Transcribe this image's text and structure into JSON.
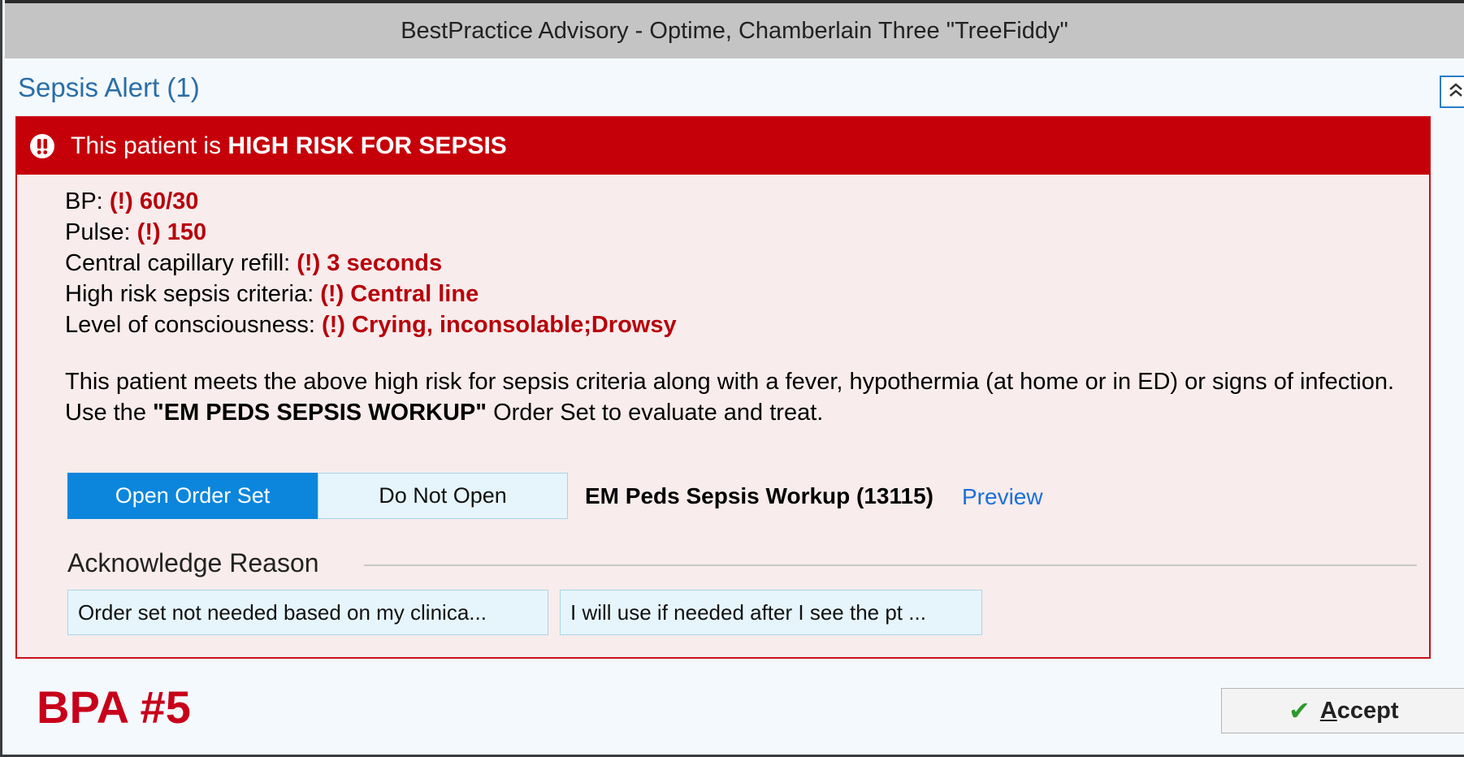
{
  "window": {
    "title": "BestPractice Advisory - Optime, Chamberlain Three \"TreeFiddy\""
  },
  "section": {
    "title": "Sepsis Alert",
    "count": "(1)"
  },
  "alert": {
    "header_prefix": "This patient is ",
    "header_emphasis": "HIGH RISK FOR SEPSIS",
    "icon": "exclamation-circle-icon",
    "criteria": [
      {
        "label": "BP: ",
        "value": "(!) 60/30"
      },
      {
        "label": "Pulse: ",
        "value": "(!) 150"
      },
      {
        "label": "Central capillary refill: ",
        "value": "(!) 3 seconds"
      },
      {
        "label": "High risk sepsis criteria: ",
        "value": "(!) Central line"
      },
      {
        "label": "Level of consciousness: ",
        "value": "(!) Crying, inconsolable;Drowsy"
      }
    ],
    "message_part1": "This patient meets the above high risk for sepsis criteria along with a fever, hypothermia (at home or in ED) or signs of infection. Use the ",
    "message_emphasis": "\"EM PEDS SEPSIS WORKUP\"",
    "message_part2": " Order Set to evaluate and treat.",
    "open_button": "Open Order Set",
    "do_not_open_button": "Do Not Open",
    "order_set_name": "EM Peds Sepsis Workup (13115)",
    "preview_link": "Preview",
    "acknowledge_label": "Acknowledge Reason",
    "reasons": [
      "Order set not needed based on my clinica...",
      "I will use if needed after I see the pt ..."
    ]
  },
  "footer": {
    "bpa_label": "BPA #5",
    "accept_first_letter": "A",
    "accept_rest": "ccept"
  },
  "colors": {
    "alert_red": "#c60008",
    "value_red": "#b8000a",
    "primary_blue": "#0b86dc",
    "link_blue": "#1a6fdc",
    "title_blue": "#2a6ea6"
  }
}
